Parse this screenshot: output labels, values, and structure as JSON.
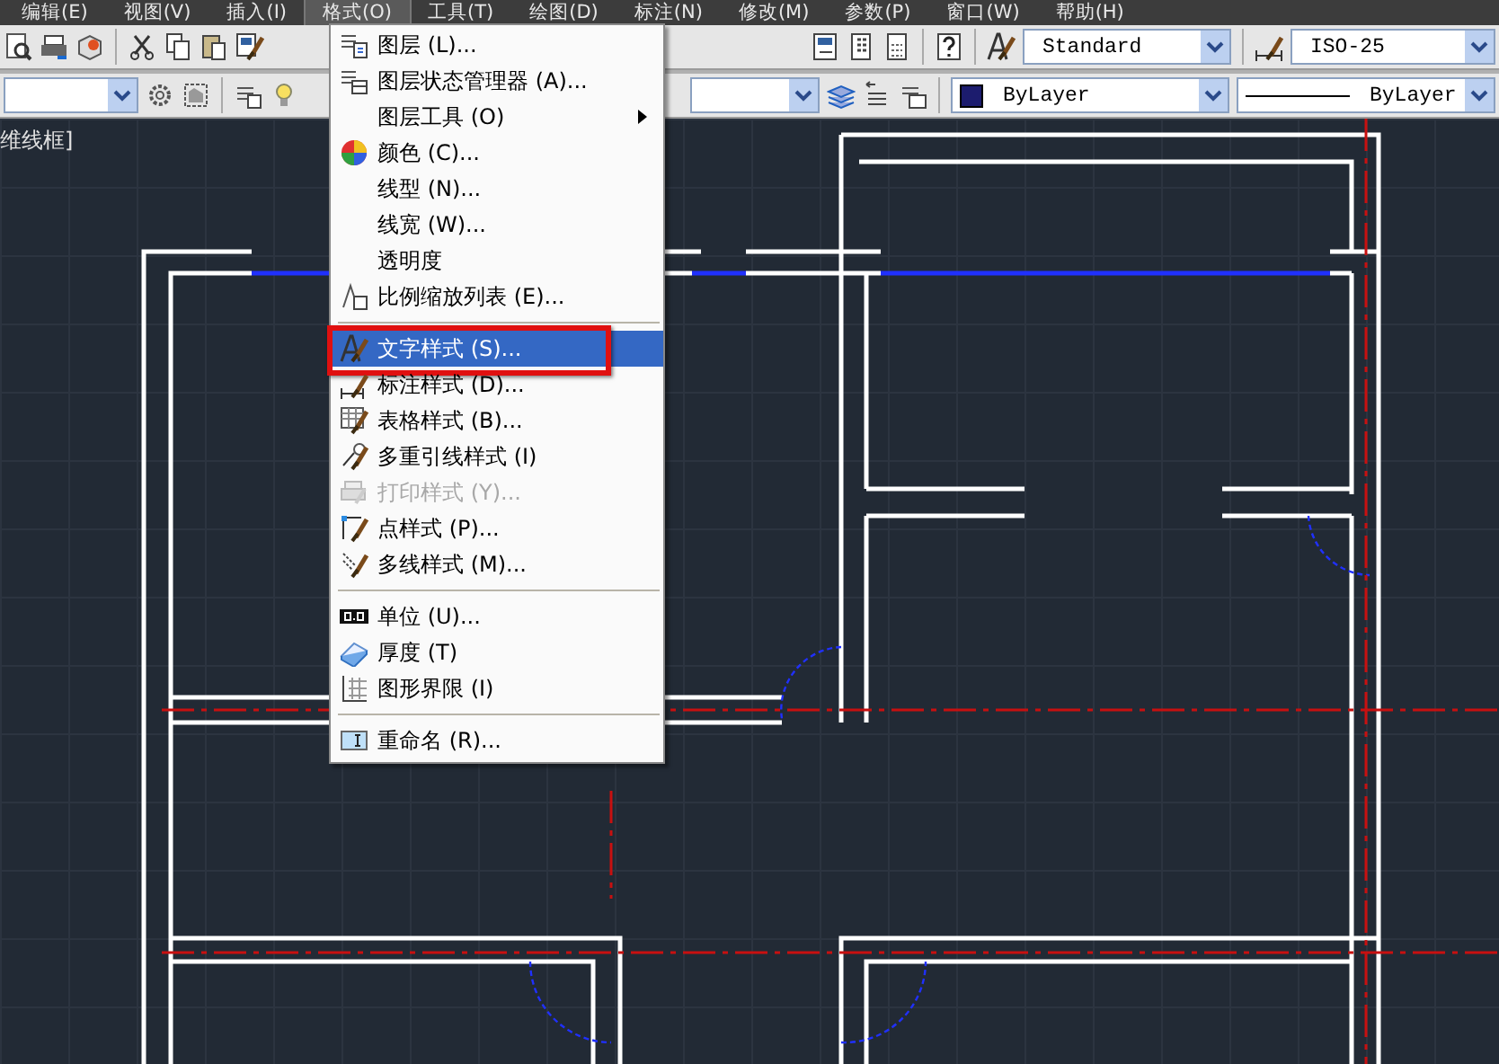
{
  "menu_bar": [
    {
      "label": "编辑(E)",
      "selected": false
    },
    {
      "label": "视图(V)",
      "selected": false
    },
    {
      "label": "插入(I)",
      "selected": false
    },
    {
      "label": "格式(O)",
      "selected": true
    },
    {
      "label": "工具(T)",
      "selected": false
    },
    {
      "label": "绘图(D)",
      "selected": false
    },
    {
      "label": "标注(N)",
      "selected": false
    },
    {
      "label": "修改(M)",
      "selected": false
    },
    {
      "label": "参数(P)",
      "selected": false
    },
    {
      "label": "窗口(W)",
      "selected": false
    },
    {
      "label": "帮助(H)",
      "selected": false
    }
  ],
  "toolbar": {
    "text_style": "Standard",
    "dim_style": "ISO-25",
    "color_label": "ByLayer",
    "linetype": "ByLayer"
  },
  "viewport_label": "维线框]",
  "format_menu": [
    {
      "kind": "layers",
      "label": "图层 (L)...",
      "selected": false,
      "disabled": false,
      "submenu": false,
      "annotated": false
    },
    {
      "kind": "layer-state",
      "label": "图层状态管理器 (A)...",
      "selected": false,
      "disabled": false,
      "submenu": false,
      "annotated": false
    },
    {
      "kind": "plain",
      "label": "图层工具 (O)",
      "selected": false,
      "disabled": false,
      "submenu": true,
      "annotated": false
    },
    {
      "kind": "color-wheel",
      "label": "颜色 (C)...",
      "selected": false,
      "disabled": false,
      "submenu": false,
      "annotated": false
    },
    {
      "kind": "plain",
      "label": "线型 (N)...",
      "selected": false,
      "disabled": false,
      "submenu": false,
      "annotated": false
    },
    {
      "kind": "plain",
      "label": "线宽 (W)...",
      "selected": false,
      "disabled": false,
      "submenu": false,
      "annotated": false
    },
    {
      "kind": "plain",
      "label": "透明度",
      "selected": false,
      "disabled": false,
      "submenu": false,
      "annotated": false
    },
    {
      "kind": "scale-list",
      "label": "比例缩放列表 (E)...",
      "selected": false,
      "disabled": false,
      "submenu": false,
      "annotated": false
    },
    {
      "kind": "separator"
    },
    {
      "kind": "text-style",
      "label": "文字样式 (S)...",
      "selected": true,
      "disabled": false,
      "submenu": false,
      "annotated": true
    },
    {
      "kind": "dim-style",
      "label": "标注样式 (D)...",
      "selected": false,
      "disabled": false,
      "submenu": false,
      "annotated": false
    },
    {
      "kind": "table-style",
      "label": "表格样式 (B)...",
      "selected": false,
      "disabled": false,
      "submenu": false,
      "annotated": false
    },
    {
      "kind": "multileader",
      "label": "多重引线样式 (I)",
      "selected": false,
      "disabled": false,
      "submenu": false,
      "annotated": false
    },
    {
      "kind": "plot-style",
      "label": "打印样式 (Y)...",
      "selected": false,
      "disabled": true,
      "submenu": false,
      "annotated": false
    },
    {
      "kind": "point-style",
      "label": "点样式 (P)...",
      "selected": false,
      "disabled": false,
      "submenu": false,
      "annotated": false
    },
    {
      "kind": "multiline",
      "label": "多线样式 (M)...",
      "selected": false,
      "disabled": false,
      "submenu": false,
      "annotated": false
    },
    {
      "kind": "separator"
    },
    {
      "kind": "units",
      "label": "单位 (U)...",
      "selected": false,
      "disabled": false,
      "submenu": false,
      "annotated": false
    },
    {
      "kind": "thickness",
      "label": "厚度 (T)",
      "selected": false,
      "disabled": false,
      "submenu": false,
      "annotated": false
    },
    {
      "kind": "limits",
      "label": "图形界限 (I)",
      "selected": false,
      "disabled": false,
      "submenu": false,
      "annotated": false
    },
    {
      "kind": "separator"
    },
    {
      "kind": "rename",
      "label": "重命名 (R)...",
      "selected": false,
      "disabled": false,
      "submenu": false,
      "annotated": false
    }
  ]
}
